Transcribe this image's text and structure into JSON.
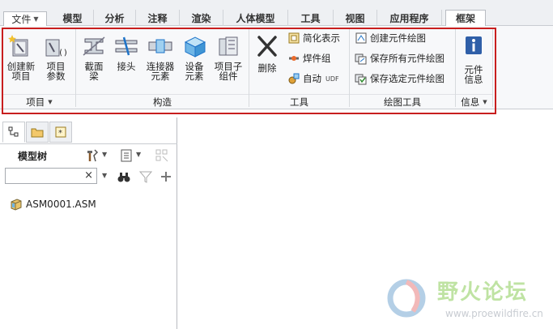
{
  "tabs": {
    "file": "文件",
    "items": [
      "模型",
      "分析",
      "注释",
      "渲染",
      "人体模型",
      "工具",
      "视图",
      "应用程序",
      "框架"
    ],
    "active": "框架"
  },
  "ribbon": {
    "highlight_color": "#c81e1e",
    "groups": {
      "project": "项目",
      "construct": "构造",
      "tools": "工具",
      "drawing_tools": "绘图工具",
      "info": "信息"
    },
    "buttons": {
      "create_new_project": "创建新\n项目",
      "project_params": "项目\n参数",
      "section_beam": "截面\n梁",
      "joint": "接头",
      "connector_element": "连接器\n元素",
      "equipment_element": "设备\n元素",
      "project_subassembly": "项目子\n组件",
      "delete": "删除",
      "simplified_rep": "简化表示",
      "weld_group": "焊件组",
      "auto": "自动",
      "udf": "UDF",
      "create_element_drawing": "创建元件绘图",
      "save_all_element_drawings": "保存所有元件绘图",
      "save_selected_element_drawings": "保存选定元件绘图",
      "element_info": "元件\n信息"
    }
  },
  "panel": {
    "tree_title": "模型树",
    "search_value": "",
    "search_clear": "×",
    "tree_items": [
      "ASM0001.ASM"
    ]
  },
  "watermark": {
    "title": "野火论坛",
    "url": "www.proewildfire.cn"
  }
}
